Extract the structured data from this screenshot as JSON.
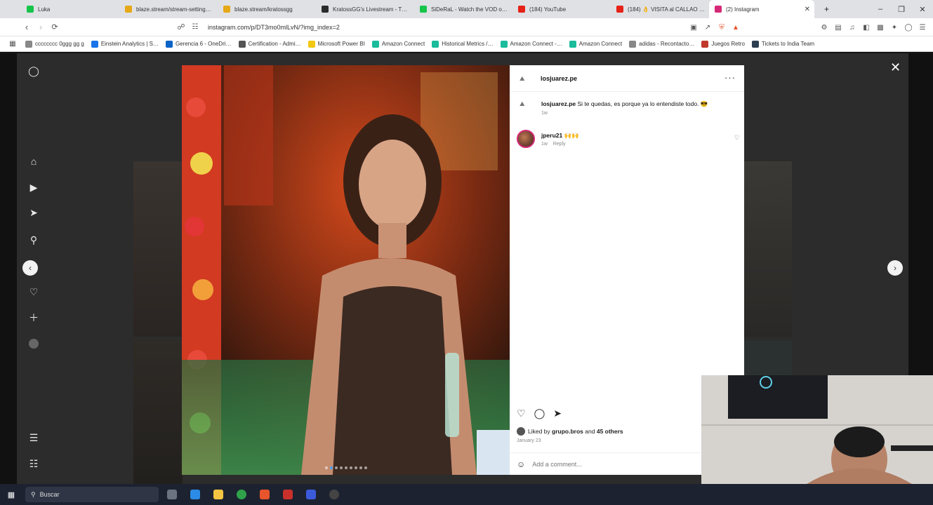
{
  "browser": {
    "tabs": [
      {
        "title": "Luka",
        "color": "#17c44a",
        "active": false
      },
      {
        "title": "blaze.stream/stream-settings/…",
        "color": "#e6a817",
        "active": false
      },
      {
        "title": "blaze.stream/kratossgg",
        "color": "#e6a817",
        "active": false
      },
      {
        "title": "KratossGG's Livestream - The …",
        "color": "#2b2b2b",
        "active": false
      },
      {
        "title": "SiDeRaL - Watch the VOD on …",
        "color": "#17c44a",
        "active": false
      },
      {
        "title": "(184) YouTube",
        "color": "#e62117",
        "active": false
      },
      {
        "title": "(184) 👌 VISITA al CALLAO 😎",
        "color": "#e62117",
        "active": false
      },
      {
        "title": "(2) Instagram",
        "color": "#d62976",
        "active": true
      }
    ],
    "url": "instagram.com/p/DT3mo0mlLvN/?img_index=2",
    "bookmarks": [
      {
        "label": "cccccccc 0ggg gg g",
        "color": "#888"
      },
      {
        "label": "Einstein Analytics | S…",
        "color": "#1a73e8"
      },
      {
        "label": "Gerencia 6 - OneDri…",
        "color": "#0a64c8"
      },
      {
        "label": "Certification - Admi…",
        "color": "#555"
      },
      {
        "label": "Microsoft Power BI",
        "color": "#f2c811"
      },
      {
        "label": "Amazon Connect",
        "color": "#1abc9c"
      },
      {
        "label": "Historical Metrics /…",
        "color": "#1abc9c"
      },
      {
        "label": "Amazon Connect -…",
        "color": "#1abc9c"
      },
      {
        "label": "Amazon Connect",
        "color": "#1abc9c"
      },
      {
        "label": "adidas - Recontacto…",
        "color": "#888"
      },
      {
        "label": "Juegos Retro",
        "color": "#c0392b"
      },
      {
        "label": "Tickets to India Team",
        "color": "#2c3e50"
      }
    ]
  },
  "post": {
    "username": "losjuarez.pe",
    "caption": "Si te quedas, es porque ya lo entendiste todo. 😎",
    "caption_time": "1w",
    "comments": [
      {
        "user": "jperu21 🙌🙌",
        "time": "1w",
        "reply": "Reply"
      }
    ],
    "liked_by_prefix": "Liked by",
    "liked_by_user": "grupo.bros",
    "liked_by_suffix": "and",
    "liked_by_others": "45 others",
    "date": "January 23",
    "comment_placeholder": "Add a comment...",
    "more_label": "···",
    "image_dots": 9,
    "image_index": 2
  },
  "taskbar": {
    "search_label": "Buscar"
  },
  "icons": {
    "close": "✕",
    "prev": "‹",
    "next": "›"
  }
}
